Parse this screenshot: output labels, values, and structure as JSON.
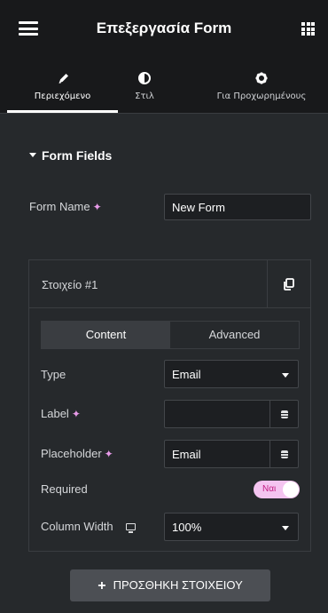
{
  "header": {
    "title": "Επεξεργασία Form",
    "menu_icon": "hamburger-icon",
    "apps_icon": "grid-icon"
  },
  "tabs": [
    {
      "label": "Περιεχόμενο",
      "icon": "pencil-icon",
      "active": true
    },
    {
      "label": "Στιλ",
      "icon": "contrast-icon",
      "active": false
    },
    {
      "label": "Για Προχωρημένους",
      "icon": "gear-icon",
      "active": false
    }
  ],
  "section": {
    "title": "Form Fields"
  },
  "form_name": {
    "label": "Form Name",
    "value": "New Form"
  },
  "item": {
    "title": "Στοιχείο #1",
    "subtabs": {
      "content": "Content",
      "advanced": "Advanced"
    },
    "type": {
      "label": "Type",
      "value": "Email"
    },
    "label_field": {
      "label": "Label",
      "value": ""
    },
    "placeholder": {
      "label": "Placeholder",
      "value": "Email"
    },
    "required": {
      "label": "Required",
      "toggle_text": "Ναι",
      "on": true
    },
    "column_width": {
      "label": "Column Width",
      "value": "100%"
    }
  },
  "add_button": {
    "label": "ΠΡΟΣΘΗΚΗ ΣΤΟΙΧΕΙΟΥ"
  },
  "colors": {
    "accent_toggle": "#f4c4f0",
    "toggle_text": "#c21d82",
    "sparkle": "#e79ae8"
  }
}
